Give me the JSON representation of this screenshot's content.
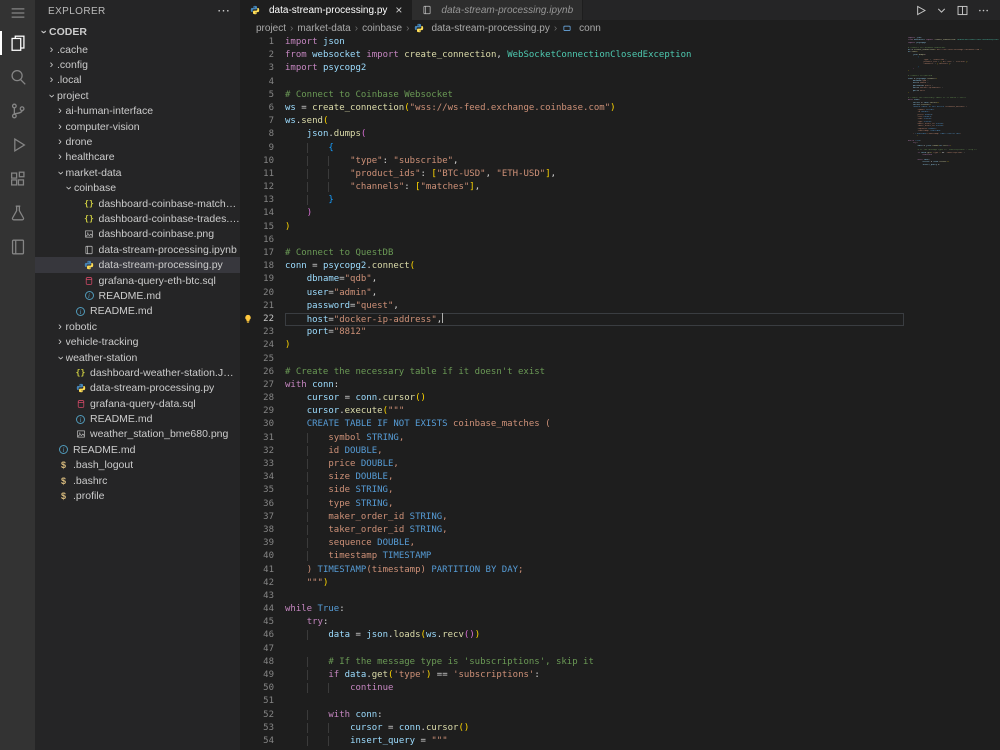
{
  "colors": {
    "syntax": {
      "k": "#c586c0",
      "b": "#569cd6",
      "v": "#9cdcfe",
      "f": "#dcdcaa",
      "s": "#ce9178",
      "c": "#6a9955",
      "w": "#d4d4d4",
      "t": "#4ec9b0",
      "g": "#ffd700",
      "p": "#da70d6",
      "u": "#179fff"
    },
    "ui": {
      "activityBar": "#333333",
      "sideBar": "#252526",
      "editor": "#1e1e1e",
      "tabsBar": "#252526",
      "tabActive": "#1e1e1e",
      "tabInactive": "#2d2d2d",
      "listSelection": "#37373d",
      "lineNumber": "#858585",
      "lineNumberActive": "#c6c6c6",
      "breadcrumb": "#a9a9a9",
      "icon": "#858585"
    },
    "fileIcons": {
      "json": "#cbcb41",
      "python-blue": "#4584b6",
      "python-yellow": "#ffde57",
      "neutral": "#c5c5c5",
      "sql": "#e34c6d",
      "info": "#519aba",
      "shell": "#d7ba7d",
      "symbol": "#75beff",
      "lightbulb": "#ffc83d"
    }
  },
  "activity_bar": {
    "items": [
      {
        "name": "menu",
        "icon": "menu",
        "active": false
      },
      {
        "name": "explorer",
        "icon": "files",
        "active": true
      },
      {
        "name": "search",
        "icon": "search",
        "active": false
      },
      {
        "name": "source-control",
        "icon": "git",
        "active": false
      },
      {
        "name": "run-and-debug",
        "icon": "debug",
        "active": false
      },
      {
        "name": "extensions",
        "icon": "extensions",
        "active": false
      },
      {
        "name": "testing",
        "icon": "beaker",
        "active": false
      },
      {
        "name": "notebooks",
        "icon": "book",
        "active": false
      }
    ]
  },
  "sidebar": {
    "title": "EXPLORER",
    "more_glyph": "⋯",
    "chevron_glyph": "›",
    "section": "CODER",
    "tree": [
      {
        "label": ".cache",
        "kind": "folder",
        "level": 1,
        "expanded": false
      },
      {
        "label": ".config",
        "kind": "folder",
        "level": 1,
        "expanded": false
      },
      {
        "label": ".local",
        "kind": "folder",
        "level": 1,
        "expanded": false
      },
      {
        "label": "project",
        "kind": "folder",
        "level": 1,
        "expanded": true
      },
      {
        "label": "ai-human-interface",
        "kind": "folder",
        "level": 2,
        "expanded": false
      },
      {
        "label": "computer-vision",
        "kind": "folder",
        "level": 2,
        "expanded": false
      },
      {
        "label": "drone",
        "kind": "folder",
        "level": 2,
        "expanded": false
      },
      {
        "label": "healthcare",
        "kind": "folder",
        "level": 2,
        "expanded": false
      },
      {
        "label": "market-data",
        "kind": "folder",
        "level": 2,
        "expanded": true
      },
      {
        "label": "coinbase",
        "kind": "folder",
        "level": 3,
        "expanded": true
      },
      {
        "label": "dashboard-coinbase-matches.json",
        "kind": "file",
        "icon": "json",
        "level": 4
      },
      {
        "label": "dashboard-coinbase-trades.json",
        "kind": "file",
        "icon": "json",
        "level": 4
      },
      {
        "label": "dashboard-coinbase.png",
        "kind": "file",
        "icon": "image",
        "level": 4
      },
      {
        "label": "data-stream-processing.ipynb",
        "kind": "file",
        "icon": "notebook",
        "level": 4
      },
      {
        "label": "data-stream-processing.py",
        "kind": "file",
        "icon": "python",
        "level": 4,
        "selected": true
      },
      {
        "label": "grafana-query-eth-btc.sql",
        "kind": "file",
        "icon": "sql",
        "level": 4
      },
      {
        "label": "README.md",
        "kind": "file",
        "icon": "info",
        "level": 4
      },
      {
        "label": "README.md",
        "kind": "file",
        "icon": "info",
        "level": 3
      },
      {
        "label": "robotic",
        "kind": "folder",
        "level": 2,
        "expanded": false
      },
      {
        "label": "vehicle-tracking",
        "kind": "folder",
        "level": 2,
        "expanded": false
      },
      {
        "label": "weather-station",
        "kind": "folder",
        "level": 2,
        "expanded": true
      },
      {
        "label": "dashboard-weather-station.JSON",
        "kind": "file",
        "icon": "json",
        "level": 3
      },
      {
        "label": "data-stream-processing.py",
        "kind": "file",
        "icon": "python",
        "level": 3
      },
      {
        "label": "grafana-query-data.sql",
        "kind": "file",
        "icon": "sql",
        "level": 3
      },
      {
        "label": "README.md",
        "kind": "file",
        "icon": "info",
        "level": 3
      },
      {
        "label": "weather_station_bme680.png",
        "kind": "file",
        "icon": "image",
        "level": 3
      },
      {
        "label": "README.md",
        "kind": "file",
        "icon": "info",
        "level": 1
      },
      {
        "label": ".bash_logout",
        "kind": "file",
        "icon": "shell",
        "level": 1
      },
      {
        "label": ".bashrc",
        "kind": "file",
        "icon": "shell",
        "level": 1
      },
      {
        "label": ".profile",
        "kind": "file",
        "icon": "shell",
        "level": 1
      }
    ]
  },
  "editor": {
    "tabs": [
      {
        "label": "data-stream-processing.py",
        "icon": "python",
        "active": true,
        "close_glyph": "×"
      },
      {
        "label": "data-stream-processing.ipynb",
        "icon": "notebook",
        "active": false,
        "preview": true
      }
    ],
    "actions": [
      {
        "name": "run",
        "icon": "play"
      },
      {
        "name": "run-dropdown",
        "icon": "chevron-down"
      },
      {
        "name": "split-editor",
        "icon": "split"
      },
      {
        "name": "more-actions",
        "icon": "ellipsis"
      }
    ],
    "breadcrumb_separator": "›",
    "breadcrumbs": [
      {
        "label": "project"
      },
      {
        "label": "market-data"
      },
      {
        "label": "coinbase"
      },
      {
        "label": "data-stream-processing.py",
        "icon": "python"
      },
      {
        "label": "conn",
        "icon": "symbol"
      }
    ]
  },
  "code": {
    "language": "python",
    "active_line": 22,
    "lightbulb_line": 22,
    "cursor_line": 22,
    "lines": [
      [
        [
          "k",
          "import"
        ],
        [
          "w",
          " "
        ],
        [
          "v",
          "json"
        ]
      ],
      [
        [
          "k",
          "from"
        ],
        [
          "w",
          " "
        ],
        [
          "v",
          "websocket"
        ],
        [
          "w",
          " "
        ],
        [
          "k",
          "import"
        ],
        [
          "w",
          " "
        ],
        [
          "f",
          "create_connection"
        ],
        [
          "w",
          ", "
        ],
        [
          "t",
          "WebSocketConnectionClosedException"
        ]
      ],
      [
        [
          "k",
          "import"
        ],
        [
          "w",
          " "
        ],
        [
          "v",
          "psycopg2"
        ]
      ],
      [],
      [
        [
          "c",
          "# Connect to Coinbase Websocket"
        ]
      ],
      [
        [
          "v",
          "ws"
        ],
        [
          "w",
          " = "
        ],
        [
          "f",
          "create_connection"
        ],
        [
          "g",
          "("
        ],
        [
          "s",
          "\"wss://ws-feed.exchange.coinbase.com\""
        ],
        [
          "g",
          ")"
        ]
      ],
      [
        [
          "v",
          "ws"
        ],
        [
          "w",
          "."
        ],
        [
          "f",
          "send"
        ],
        [
          "g",
          "("
        ]
      ],
      [
        [
          "w",
          "    "
        ],
        [
          "v",
          "json"
        ],
        [
          "w",
          "."
        ],
        [
          "f",
          "dumps"
        ],
        [
          "p",
          "("
        ]
      ],
      [
        [
          "w",
          "        "
        ],
        [
          "u",
          "{"
        ]
      ],
      [
        [
          "w",
          "            "
        ],
        [
          "s",
          "\"type\""
        ],
        [
          "w",
          ": "
        ],
        [
          "s",
          "\"subscribe\""
        ],
        [
          "w",
          ","
        ]
      ],
      [
        [
          "w",
          "            "
        ],
        [
          "s",
          "\"product_ids\""
        ],
        [
          "w",
          ": "
        ],
        [
          "g",
          "["
        ],
        [
          "s",
          "\"BTC-USD\""
        ],
        [
          "w",
          ", "
        ],
        [
          "s",
          "\"ETH-USD\""
        ],
        [
          "g",
          "]"
        ],
        [
          "w",
          ","
        ]
      ],
      [
        [
          "w",
          "            "
        ],
        [
          "s",
          "\"channels\""
        ],
        [
          "w",
          ": "
        ],
        [
          "g",
          "["
        ],
        [
          "s",
          "\"matches\""
        ],
        [
          "g",
          "]"
        ],
        [
          "w",
          ","
        ]
      ],
      [
        [
          "w",
          "        "
        ],
        [
          "u",
          "}"
        ]
      ],
      [
        [
          "w",
          "    "
        ],
        [
          "p",
          ")"
        ]
      ],
      [
        [
          "g",
          ")"
        ]
      ],
      [],
      [
        [
          "c",
          "# Connect to QuestDB"
        ]
      ],
      [
        [
          "v",
          "conn"
        ],
        [
          "w",
          " = "
        ],
        [
          "v",
          "psycopg2"
        ],
        [
          "w",
          "."
        ],
        [
          "f",
          "connect"
        ],
        [
          "g",
          "("
        ]
      ],
      [
        [
          "w",
          "    "
        ],
        [
          "v",
          "dbname"
        ],
        [
          "w",
          "="
        ],
        [
          "s",
          "\"qdb\""
        ],
        [
          "w",
          ","
        ]
      ],
      [
        [
          "w",
          "    "
        ],
        [
          "v",
          "user"
        ],
        [
          "w",
          "="
        ],
        [
          "s",
          "\"admin\""
        ],
        [
          "w",
          ","
        ]
      ],
      [
        [
          "w",
          "    "
        ],
        [
          "v",
          "password"
        ],
        [
          "w",
          "="
        ],
        [
          "s",
          "\"quest\""
        ],
        [
          "w",
          ","
        ]
      ],
      [
        [
          "w",
          "    "
        ],
        [
          "v",
          "host"
        ],
        [
          "w",
          "="
        ],
        [
          "s",
          "\"docker-ip-address\""
        ],
        [
          "w",
          ","
        ]
      ],
      [
        [
          "w",
          "    "
        ],
        [
          "v",
          "port"
        ],
        [
          "w",
          "="
        ],
        [
          "s",
          "\"8812\""
        ]
      ],
      [
        [
          "g",
          ")"
        ]
      ],
      [],
      [
        [
          "c",
          "# Create the necessary table if it doesn't exist"
        ]
      ],
      [
        [
          "k",
          "with"
        ],
        [
          "w",
          " "
        ],
        [
          "v",
          "conn"
        ],
        [
          "w",
          ":"
        ]
      ],
      [
        [
          "w",
          "    "
        ],
        [
          "v",
          "cursor"
        ],
        [
          "w",
          " = "
        ],
        [
          "v",
          "conn"
        ],
        [
          "w",
          "."
        ],
        [
          "f",
          "cursor"
        ],
        [
          "g",
          "()"
        ]
      ],
      [
        [
          "w",
          "    "
        ],
        [
          "v",
          "cursor"
        ],
        [
          "w",
          "."
        ],
        [
          "f",
          "execute"
        ],
        [
          "g",
          "("
        ],
        [
          "s",
          "\"\"\""
        ]
      ],
      [
        [
          "w",
          "    "
        ],
        [
          "b",
          "CREATE TABLE IF NOT EXISTS"
        ],
        [
          "s",
          " coinbase_matches ("
        ]
      ],
      [
        [
          "w",
          "        "
        ],
        [
          "s",
          "symbol "
        ],
        [
          "b",
          "STRING"
        ],
        [
          "s",
          ","
        ]
      ],
      [
        [
          "w",
          "        "
        ],
        [
          "s",
          "id "
        ],
        [
          "b",
          "DOUBLE"
        ],
        [
          "s",
          ","
        ]
      ],
      [
        [
          "w",
          "        "
        ],
        [
          "s",
          "price "
        ],
        [
          "b",
          "DOUBLE"
        ],
        [
          "s",
          ","
        ]
      ],
      [
        [
          "w",
          "        "
        ],
        [
          "s",
          "size "
        ],
        [
          "b",
          "DOUBLE"
        ],
        [
          "s",
          ","
        ]
      ],
      [
        [
          "w",
          "        "
        ],
        [
          "s",
          "side "
        ],
        [
          "b",
          "STRING"
        ],
        [
          "s",
          ","
        ]
      ],
      [
        [
          "w",
          "        "
        ],
        [
          "s",
          "type "
        ],
        [
          "b",
          "STRING"
        ],
        [
          "s",
          ","
        ]
      ],
      [
        [
          "w",
          "        "
        ],
        [
          "s",
          "maker_order_id "
        ],
        [
          "b",
          "STRING"
        ],
        [
          "s",
          ","
        ]
      ],
      [
        [
          "w",
          "        "
        ],
        [
          "s",
          "taker_order_id "
        ],
        [
          "b",
          "STRING"
        ],
        [
          "s",
          ","
        ]
      ],
      [
        [
          "w",
          "        "
        ],
        [
          "s",
          "sequence "
        ],
        [
          "b",
          "DOUBLE"
        ],
        [
          "s",
          ","
        ]
      ],
      [
        [
          "w",
          "        "
        ],
        [
          "s",
          "timestamp "
        ],
        [
          "b",
          "TIMESTAMP"
        ]
      ],
      [
        [
          "w",
          "    "
        ],
        [
          "s",
          ") "
        ],
        [
          "b",
          "TIMESTAMP"
        ],
        [
          "s",
          "(timestamp) "
        ],
        [
          "b",
          "PARTITION BY DAY"
        ],
        [
          "s",
          ";"
        ]
      ],
      [
        [
          "w",
          "    "
        ],
        [
          "s",
          "\"\"\""
        ],
        [
          "g",
          ")"
        ]
      ],
      [],
      [
        [
          "k",
          "while"
        ],
        [
          "w",
          " "
        ],
        [
          "b",
          "True"
        ],
        [
          "w",
          ":"
        ]
      ],
      [
        [
          "w",
          "    "
        ],
        [
          "k",
          "try"
        ],
        [
          "w",
          ":"
        ]
      ],
      [
        [
          "w",
          "        "
        ],
        [
          "v",
          "data"
        ],
        [
          "w",
          " = "
        ],
        [
          "v",
          "json"
        ],
        [
          "w",
          "."
        ],
        [
          "f",
          "loads"
        ],
        [
          "g",
          "("
        ],
        [
          "v",
          "ws"
        ],
        [
          "w",
          "."
        ],
        [
          "f",
          "recv"
        ],
        [
          "p",
          "()"
        ],
        [
          "g",
          ")"
        ]
      ],
      [],
      [
        [
          "w",
          "        "
        ],
        [
          "c",
          "# If the message type is 'subscriptions', skip it"
        ]
      ],
      [
        [
          "w",
          "        "
        ],
        [
          "k",
          "if"
        ],
        [
          "w",
          " "
        ],
        [
          "v",
          "data"
        ],
        [
          "w",
          "."
        ],
        [
          "f",
          "get"
        ],
        [
          "g",
          "("
        ],
        [
          "s",
          "'type'"
        ],
        [
          "g",
          ")"
        ],
        [
          "w",
          " == "
        ],
        [
          "s",
          "'subscriptions'"
        ],
        [
          "w",
          ":"
        ]
      ],
      [
        [
          "w",
          "            "
        ],
        [
          "k",
          "continue"
        ]
      ],
      [],
      [
        [
          "w",
          "        "
        ],
        [
          "k",
          "with"
        ],
        [
          "w",
          " "
        ],
        [
          "v",
          "conn"
        ],
        [
          "w",
          ":"
        ]
      ],
      [
        [
          "w",
          "            "
        ],
        [
          "v",
          "cursor"
        ],
        [
          "w",
          " = "
        ],
        [
          "v",
          "conn"
        ],
        [
          "w",
          "."
        ],
        [
          "f",
          "cursor"
        ],
        [
          "g",
          "()"
        ]
      ],
      [
        [
          "w",
          "            "
        ],
        [
          "v",
          "insert_query"
        ],
        [
          "w",
          " = "
        ],
        [
          "s",
          "\"\"\""
        ]
      ]
    ]
  }
}
